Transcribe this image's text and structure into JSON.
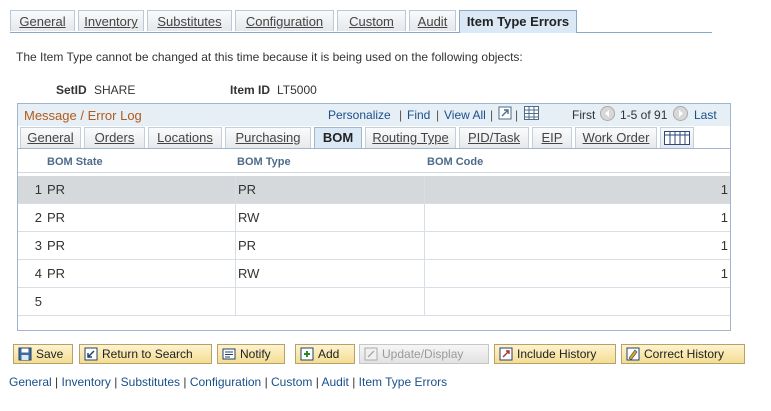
{
  "top_tabs": [
    {
      "label": "General"
    },
    {
      "label": "Inventory"
    },
    {
      "label": "Substitutes"
    },
    {
      "label": "Configuration"
    },
    {
      "label": "Custom"
    },
    {
      "label": "Audit"
    },
    {
      "label": "Item Type Errors",
      "active": true
    }
  ],
  "message": "The Item Type cannot be changed at this time because it is being used on the following objects:",
  "setid": {
    "label": "SetID",
    "value": "SHARE"
  },
  "itemid": {
    "label": "Item ID",
    "value": "LT5000"
  },
  "grid": {
    "title": "Message / Error Log",
    "personalize": "Personalize",
    "find": "Find",
    "view_all": "View All",
    "first": "First",
    "range": "1-5 of 91",
    "last": "Last",
    "tabs": [
      {
        "label": "General"
      },
      {
        "label": "Orders"
      },
      {
        "label": "Locations"
      },
      {
        "label": "Purchasing"
      },
      {
        "label": "BOM",
        "active": true
      },
      {
        "label": "Routing Type"
      },
      {
        "label": "PID/Task"
      },
      {
        "label": "EIP"
      },
      {
        "label": "Work Order"
      }
    ],
    "columns": [
      "BOM State",
      "BOM Type",
      "BOM Code"
    ],
    "rows": [
      {
        "num": "1",
        "state": "PR",
        "type": "PR",
        "code": "1"
      },
      {
        "num": "2",
        "state": "PR",
        "type": "RW",
        "code": "1"
      },
      {
        "num": "3",
        "state": "PR",
        "type": "PR",
        "code": "1"
      },
      {
        "num": "4",
        "state": "PR",
        "type": "RW",
        "code": "1"
      },
      {
        "num": "5",
        "state": "",
        "type": "",
        "code": ""
      }
    ]
  },
  "buttons": {
    "save": "Save",
    "return": "Return to Search",
    "notify": "Notify",
    "add": "Add",
    "update": "Update/Display",
    "include": "Include History",
    "correct": "Correct History"
  },
  "bottom_links": [
    "General",
    "Inventory",
    "Substitutes",
    "Configuration",
    "Custom",
    "Audit",
    "Item Type Errors"
  ],
  "colors": {
    "accent": "#1a4f8a",
    "title": "#b25a1a",
    "selected_row": "#d5d9db",
    "button": "#f4dd92"
  }
}
